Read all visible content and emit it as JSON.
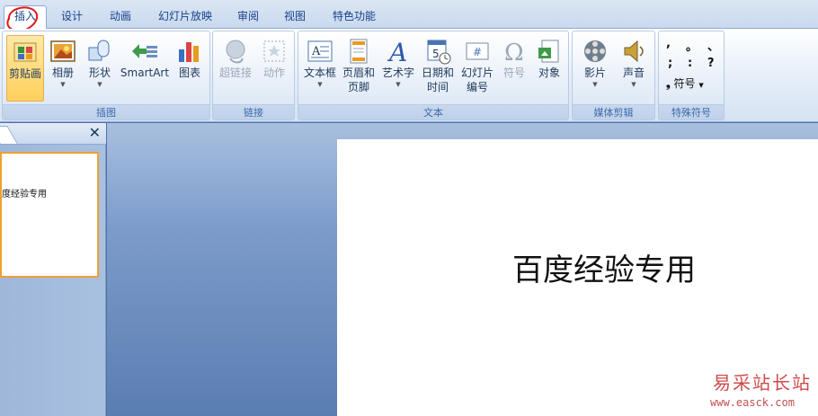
{
  "tabs": [
    {
      "label": "插入"
    },
    {
      "label": "设计"
    },
    {
      "label": "动画"
    },
    {
      "label": "幻灯片放映"
    },
    {
      "label": "审阅"
    },
    {
      "label": "视图"
    },
    {
      "label": "特色功能"
    }
  ],
  "ribbon": {
    "groups": {
      "illustrations": {
        "label": "插图",
        "buttons": [
          {
            "label": "剪贴画"
          },
          {
            "label": "相册"
          },
          {
            "label": "形状"
          },
          {
            "label": "SmartArt"
          },
          {
            "label": "图表"
          }
        ]
      },
      "links": {
        "label": "链接",
        "buttons": [
          {
            "label": "超链接"
          },
          {
            "label": "动作"
          }
        ]
      },
      "text": {
        "label": "文本",
        "buttons": [
          {
            "label": "文本框"
          },
          {
            "line1": "页眉和",
            "line2": "页脚"
          },
          {
            "label": "艺术字"
          },
          {
            "line1": "日期和",
            "line2": "时间"
          },
          {
            "line1": "幻灯片",
            "line2": "编号"
          },
          {
            "label": "符号"
          },
          {
            "label": "对象"
          }
        ]
      },
      "media": {
        "label": "媒体剪辑",
        "buttons": [
          {
            "label": "影片"
          },
          {
            "label": "声音"
          }
        ]
      },
      "special": {
        "label": "特殊符号",
        "row1": [
          ",",
          "。",
          "、"
        ],
        "row2": [
          ";",
          ":",
          "?"
        ],
        "symbol_label": "符号"
      }
    }
  },
  "slide_thumb": {
    "text": "度经验专用"
  },
  "slide": {
    "title": "百度经验专用"
  },
  "watermark": {
    "line1": "易采站长站",
    "line2": "www.easck.com"
  },
  "icons": {
    "close": "close-icon",
    "clipart": "clipart-icon",
    "album": "album-icon",
    "shapes": "shapes-icon",
    "smartart": "smartart-icon",
    "chart": "chart-icon",
    "hyperlink": "globe-link-icon",
    "action": "action-star-icon",
    "textbox": "textbox-icon",
    "header-footer": "page-icon",
    "wordart": "wordart-icon",
    "datetime": "calendar-icon",
    "slide-number": "slide-number-icon",
    "symbol": "omega-icon",
    "object": "object-icon",
    "movie": "film-reel-icon",
    "sound": "speaker-icon"
  },
  "colors": {
    "accent": "#15428b",
    "ribbon_label": "#3e6aaa",
    "pressed": "#ffcf5c",
    "thumb_border": "#f0a030",
    "annotation": "#e01818",
    "watermark": "#d04a4a"
  }
}
